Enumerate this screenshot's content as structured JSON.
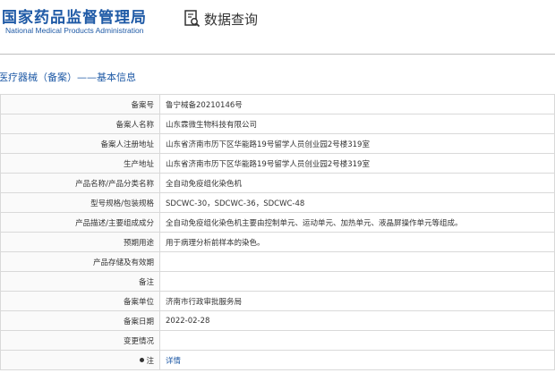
{
  "header": {
    "logo_cn": "国家药品监督管理局",
    "logo_en": "National Medical Products Administration",
    "module_title": "数据查询",
    "module_icon": "document-search-icon"
  },
  "section_title": "医疗器械（备案）——基本信息",
  "colors": {
    "brand": "#1f5aa6",
    "border": "#d9d9d9",
    "label_bg": "#fafafa"
  },
  "rows": [
    {
      "label": "备案号",
      "value": "鲁宁械备20210146号"
    },
    {
      "label": "备案人名称",
      "value": "山东霖微生物科技有限公司"
    },
    {
      "label": "备案人注册地址",
      "value": "山东省济南市历下区华能路19号留学人员创业园2号楼319室"
    },
    {
      "label": "生产地址",
      "value": "山东省济南市历下区华能路19号留学人员创业园2号楼319室"
    },
    {
      "label": "产品名称/产品分类名称",
      "value": "全自动免疫组化染色机"
    },
    {
      "label": "型号规格/包装规格",
      "value": "SDCWC-30，SDCWC-36，SDCWC-48"
    },
    {
      "label": "产品描述/主要组成成分",
      "value": "全自动免疫组化染色机主要由控制单元、运动单元、加热单元、液晶屏操作单元等组成。"
    },
    {
      "label": "预期用途",
      "value": "用于病理分析前样本的染色。"
    },
    {
      "label": "产品存储及有效期",
      "value": ""
    },
    {
      "label": "备注",
      "value": ""
    },
    {
      "label": "备案单位",
      "value": "济南市行政审批服务局"
    },
    {
      "label": "备案日期",
      "value": "2022-02-28"
    },
    {
      "label": "变更情况",
      "value": ""
    },
    {
      "label": "注",
      "value": "详情",
      "icon": "dot-icon"
    }
  ]
}
